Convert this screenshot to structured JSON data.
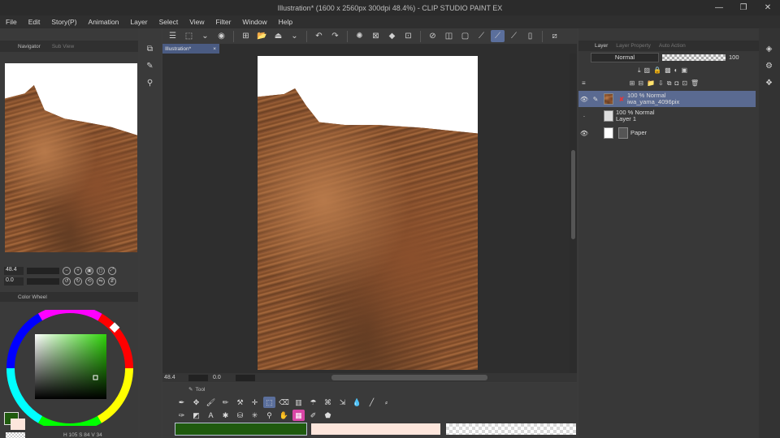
{
  "window": {
    "title": "Illustration* (1600 x 2560px 300dpi 48.4%) - CLIP STUDIO PAINT EX",
    "min": "—",
    "max": "❐",
    "close": "✕"
  },
  "menu": [
    "File",
    "Edit",
    "Story(P)",
    "Animation",
    "Layer",
    "Select",
    "View",
    "Filter",
    "Window",
    "Help"
  ],
  "navigator": {
    "tab": "Navigator",
    "tab2": "Sub View",
    "zoom": "48.4",
    "rotate": "0.0"
  },
  "colorwheel": {
    "tab": "Color Wheel",
    "hsv": "H 105 S 84 V 34"
  },
  "document": {
    "tab": "Illustration*",
    "close": "×"
  },
  "status": {
    "zoom": "48.4",
    "rotate": "0.0"
  },
  "toolpanel": {
    "tab": "Tool"
  },
  "layers": {
    "tabs": {
      "layer": "Layer",
      "props": "Layer Property",
      "search": "Auto Action"
    },
    "blend": "Normal",
    "opacity": "100",
    "items": [
      {
        "mode": "100 % Normal",
        "name": "iwa_yama_4096pix"
      },
      {
        "mode": "100 % Normal",
        "name": "Layer 1"
      },
      {
        "mode": "",
        "name": "Paper"
      }
    ]
  },
  "colors": {
    "main": "#1f5a0e",
    "sub": "#fde6dc",
    "accent": "#5b6f9c"
  }
}
